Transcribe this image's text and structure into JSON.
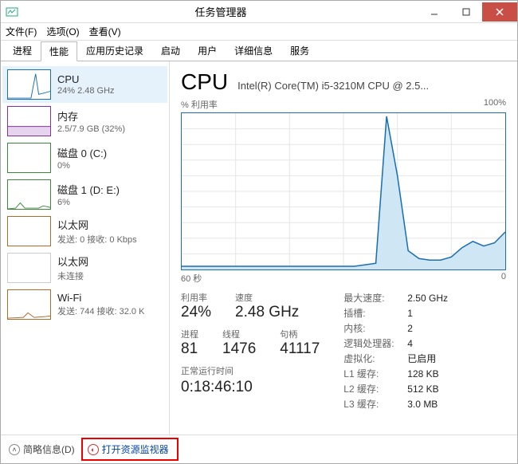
{
  "window": {
    "title": "任务管理器"
  },
  "menu": {
    "file": "文件(F)",
    "options": "选项(O)",
    "view": "查看(V)"
  },
  "tabs": [
    "进程",
    "性能",
    "应用历史记录",
    "启动",
    "用户",
    "详细信息",
    "服务"
  ],
  "active_tab": 1,
  "sidebar": [
    {
      "title": "CPU",
      "sub": "24% 2.48 GHz",
      "color": "#1a6fb0"
    },
    {
      "title": "内存",
      "sub": "2.5/7.9 GB (32%)",
      "color": "#8a2fa0"
    },
    {
      "title": "磁盘 0 (C:)",
      "sub": "0%",
      "color": "#3a8a3a"
    },
    {
      "title": "磁盘 1 (D: E:)",
      "sub": "6%",
      "color": "#3a8a3a"
    },
    {
      "title": "以太网",
      "sub": "发送: 0 接收: 0 Kbps",
      "color": "#b06a2c"
    },
    {
      "title": "以太网",
      "sub": "未连接",
      "color": "#b06a2c"
    },
    {
      "title": "Wi-Fi",
      "sub": "发送: 744 接收: 32.0 K",
      "color": "#b06a2c"
    }
  ],
  "main": {
    "title": "CPU",
    "model": "Intel(R) Core(TM) i5-3210M CPU @ 2.5...",
    "ylabel": "% 利用率",
    "ymax": "100%",
    "xlabel_left": "60 秒",
    "xlabel_right": "0"
  },
  "stats": {
    "util_lbl": "利用率",
    "util_val": "24%",
    "speed_lbl": "速度",
    "speed_val": "2.48 GHz",
    "proc_lbl": "进程",
    "proc_val": "81",
    "threads_lbl": "线程",
    "threads_val": "1476",
    "handles_lbl": "句柄",
    "handles_val": "41117",
    "uptime_lbl": "正常运行时间",
    "uptime_val": "0:18:46:10"
  },
  "details": [
    {
      "k": "最大速度:",
      "v": "2.50 GHz"
    },
    {
      "k": "插槽:",
      "v": "1"
    },
    {
      "k": "内核:",
      "v": "2"
    },
    {
      "k": "逻辑处理器:",
      "v": "4"
    },
    {
      "k": "虚拟化:",
      "v": "已启用"
    },
    {
      "k": "L1 缓存:",
      "v": "128 KB"
    },
    {
      "k": "L2 缓存:",
      "v": "512 KB"
    },
    {
      "k": "L3 缓存:",
      "v": "3.0 MB"
    }
  ],
  "footer": {
    "fewer": "简略信息(D)",
    "resmon": "打开资源监视器"
  },
  "chart_data": {
    "type": "line",
    "title": "% 利用率",
    "xlabel": "60 秒",
    "ylabel": "% 利用率",
    "ylim": [
      0,
      100
    ],
    "x_seconds_ago": [
      60,
      58,
      56,
      54,
      52,
      50,
      48,
      46,
      44,
      42,
      40,
      38,
      36,
      34,
      32,
      30,
      28,
      26,
      24,
      22,
      20,
      18,
      16,
      14,
      12,
      10,
      8,
      6,
      4,
      2,
      0
    ],
    "values_pct": [
      2,
      2,
      2,
      2,
      2,
      2,
      2,
      2,
      2,
      2,
      2,
      2,
      2,
      2,
      2,
      2,
      2,
      3,
      4,
      98,
      60,
      12,
      7,
      6,
      6,
      8,
      14,
      18,
      15,
      17,
      24
    ]
  }
}
